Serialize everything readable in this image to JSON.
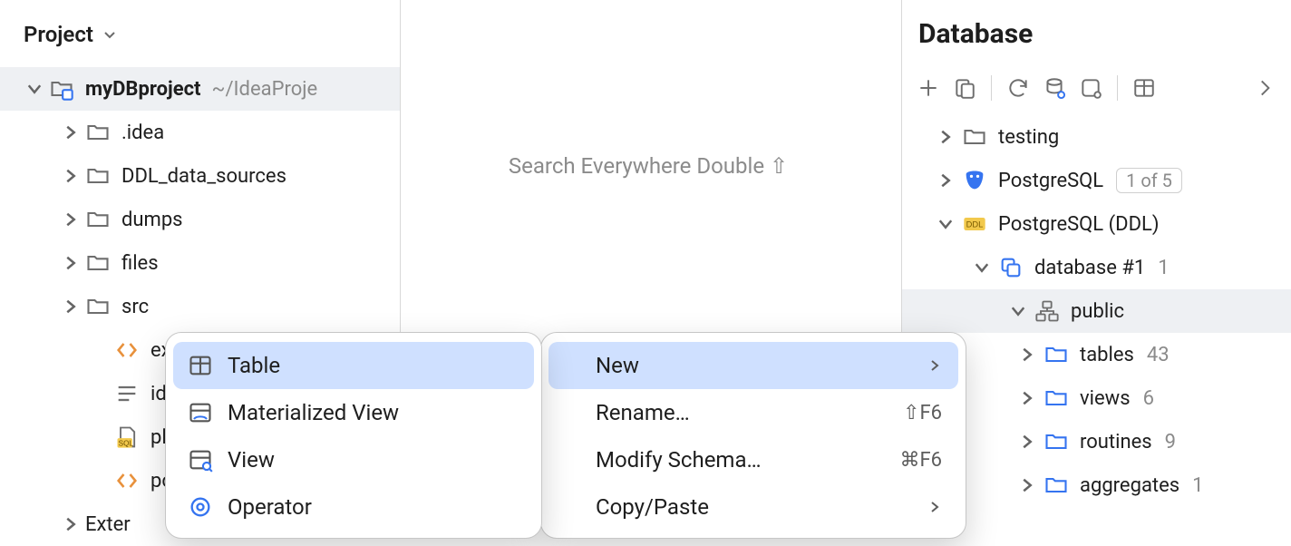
{
  "project_panel": {
    "title": "Project",
    "root": {
      "name": "myDBproject",
      "path": "~/IdeaProje"
    },
    "items": [
      {
        "label": ".idea"
      },
      {
        "label": "DDL_data_sources"
      },
      {
        "label": "dumps"
      },
      {
        "label": "files"
      },
      {
        "label": "src"
      },
      {
        "label": "ex"
      },
      {
        "label": "id"
      },
      {
        "label": "pla"
      },
      {
        "label": "po"
      },
      {
        "label": "Exter"
      }
    ]
  },
  "center_hint": "Search Everywhere Double ⇧",
  "db_panel": {
    "title": "Database",
    "tree": {
      "testing": "testing",
      "postgres": "PostgreSQL",
      "postgres_badge": "1 of 5",
      "postgres_ddl": "PostgreSQL (DDL)",
      "database1": "database #1",
      "database1_count": "1",
      "public": "public",
      "tables": "tables",
      "tables_count": "43",
      "views": "views",
      "views_count": "6",
      "routines": "routines",
      "routines_count": "9",
      "aggregates": "aggregates",
      "aggregates_count": "1"
    }
  },
  "context_menu": {
    "new": "New",
    "rename": "Rename…",
    "rename_shortcut": "⇧F6",
    "modify": "Modify Schema…",
    "modify_shortcut": "⌘F6",
    "copy_paste": "Copy/Paste"
  },
  "new_submenu": {
    "table": "Table",
    "mview": "Materialized View",
    "view": "View",
    "operator": "Operator"
  }
}
